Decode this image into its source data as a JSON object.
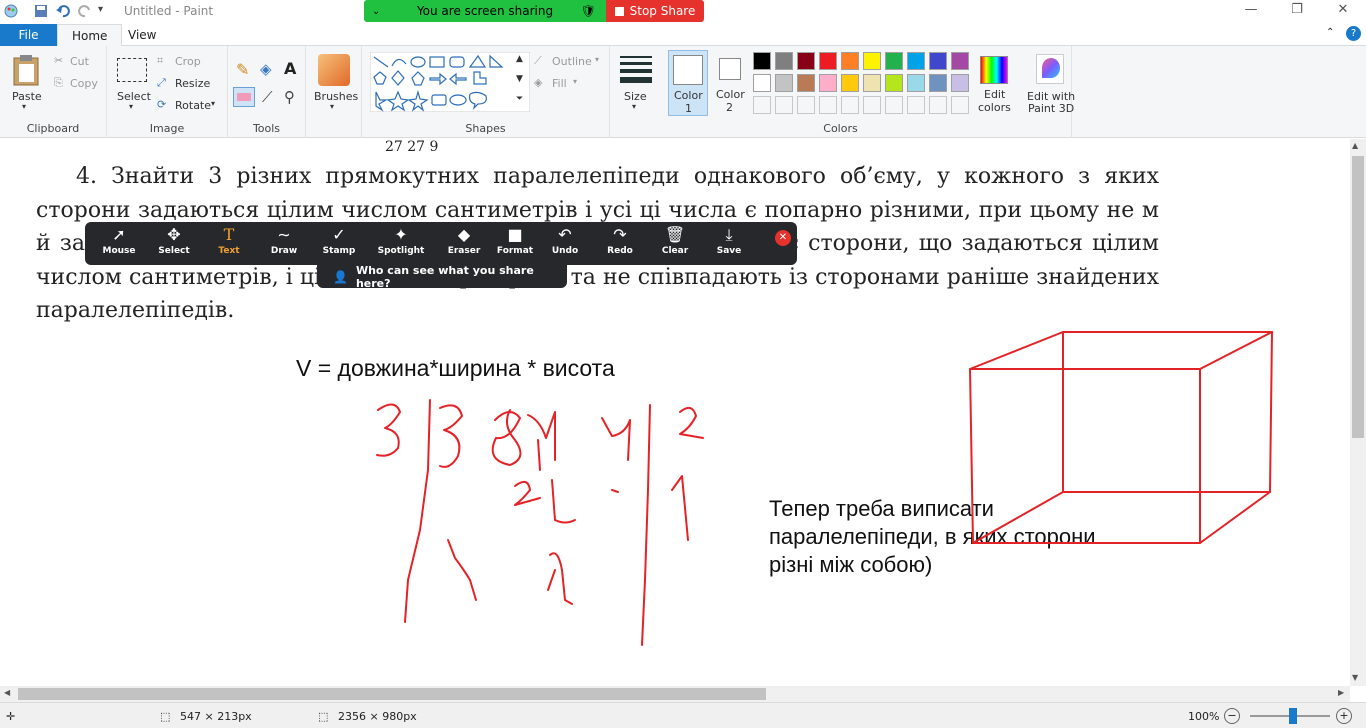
{
  "window": {
    "title": "Untitled - Paint"
  },
  "share": {
    "status": "You are screen sharing",
    "stop": "Stop Share"
  },
  "tabs": {
    "file": "File",
    "home": "Home",
    "view": "View"
  },
  "clipboard": {
    "paste": "Paste",
    "cut": "Cut",
    "copy": "Copy",
    "label": "Clipboard"
  },
  "image": {
    "select": "Select",
    "crop": "Crop",
    "resize": "Resize",
    "rotate": "Rotate",
    "label": "Image"
  },
  "tools": {
    "label": "Tools"
  },
  "brushes": {
    "label": "Brushes"
  },
  "shapes": {
    "outline": "Outline",
    "fill": "Fill",
    "label": "Shapes"
  },
  "size": {
    "label": "Size"
  },
  "color1": {
    "label1": "Color",
    "label2": "1"
  },
  "color2": {
    "label1": "Color",
    "label2": "2"
  },
  "colors": {
    "label": "Colors",
    "edit1": "Edit",
    "edit2": "colors",
    "row1": [
      "#000000",
      "#7f7f7f",
      "#880015",
      "#ed1c24",
      "#ff7f27",
      "#fff200",
      "#22b14c",
      "#00a2e8",
      "#3f48cc",
      "#a349a4"
    ],
    "row2": [
      "#ffffff",
      "#c3c3c3",
      "#b97a57",
      "#ffaec9",
      "#ffc90e",
      "#efe4b0",
      "#b5e61d",
      "#99d9ea",
      "#7092be",
      "#c8bfe7"
    ]
  },
  "paint3d": {
    "label1": "Edit with",
    "label2": "Paint 3D"
  },
  "doc": {
    "fraction_row": "27           27          9",
    "paragraph": "4. Знайти 3 різних прямокутних паралелепіпеди однакового об’єму, у кожного з яких сторони задаються цілим числом сантиметрів і усі ці числа є попарно різними, при цьому не м                                                                                      й задовольняє ці умови, тобто має однаковий об’єм з                              ми та має сторони, що задаються цілим числом сантиметрів, і ці числа попарно різні та не співпадають із сторонами раніше знайдених паралелепіпедів.",
    "formula": "V = довжина*ширина * висота",
    "note": "Тепер треба виписати паралелепіпеди, в яких сторони різні між собою)"
  },
  "zoom_toolbar": {
    "buttons": [
      {
        "label": "Mouse",
        "icon": "cursor-icon"
      },
      {
        "label": "Select",
        "icon": "move-icon"
      },
      {
        "label": "Text",
        "icon": "text-icon"
      },
      {
        "label": "Draw",
        "icon": "draw-icon"
      },
      {
        "label": "Stamp",
        "icon": "check-icon"
      },
      {
        "label": "Spotlight",
        "icon": "wand-icon"
      },
      {
        "label": "Eraser",
        "icon": "eraser-icon"
      },
      {
        "label": "Format",
        "icon": "format-icon"
      },
      {
        "label": "Undo",
        "icon": "undo-icon"
      },
      {
        "label": "Redo",
        "icon": "redo-icon"
      },
      {
        "label": "Clear",
        "icon": "trash-icon"
      },
      {
        "label": "Save",
        "icon": "save-icon"
      }
    ],
    "who": "Who can see what you share here?",
    "active_color": "#f0a030"
  },
  "status": {
    "selection": "547 × 213px",
    "canvas": "2356 × 980px",
    "zoom": "100%"
  }
}
